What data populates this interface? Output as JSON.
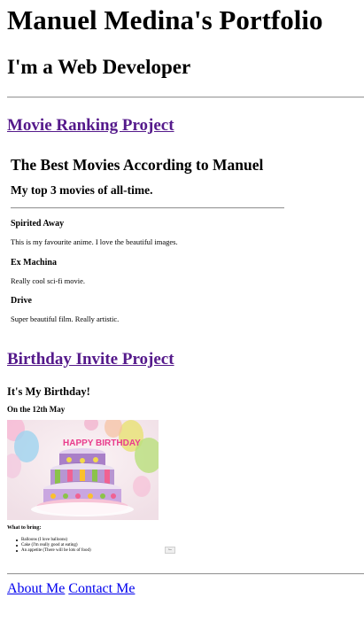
{
  "header": {
    "title": "Manuel Medina's Portfolio",
    "subtitle": "I'm a Web Developer"
  },
  "projects": {
    "movie_link": "Movie Ranking Project",
    "birthday_link": "Birthday Invite Project"
  },
  "movie_page": {
    "title": "The Best Movies According to Manuel",
    "subtitle": "My top 3 movies of all-time.",
    "movies": [
      {
        "title": "Spirited Away",
        "description": "This is my favourite anime. I love the beautiful images."
      },
      {
        "title": "Ex Machina",
        "description": "Really cool sci-fi movie."
      },
      {
        "title": "Drive",
        "description": "Super beautiful film. Really artistic."
      }
    ]
  },
  "birthday_page": {
    "title": "It's My Birthday!",
    "date": "On the 12th May",
    "cake_topper": "HAPPY BIRTHDAY",
    "bring_label": "What to bring:",
    "items": [
      "Balloons (I love balloons)",
      "Cake (I'm really good at eating)",
      "An appetite (There will be lots of food)"
    ],
    "button_label": "Done"
  },
  "footer": {
    "about": "About Me",
    "contact": "Contact Me"
  },
  "colors": {
    "visited_link": "#551a8b",
    "link": "#0000ee",
    "rule": "#9a9a9a"
  }
}
